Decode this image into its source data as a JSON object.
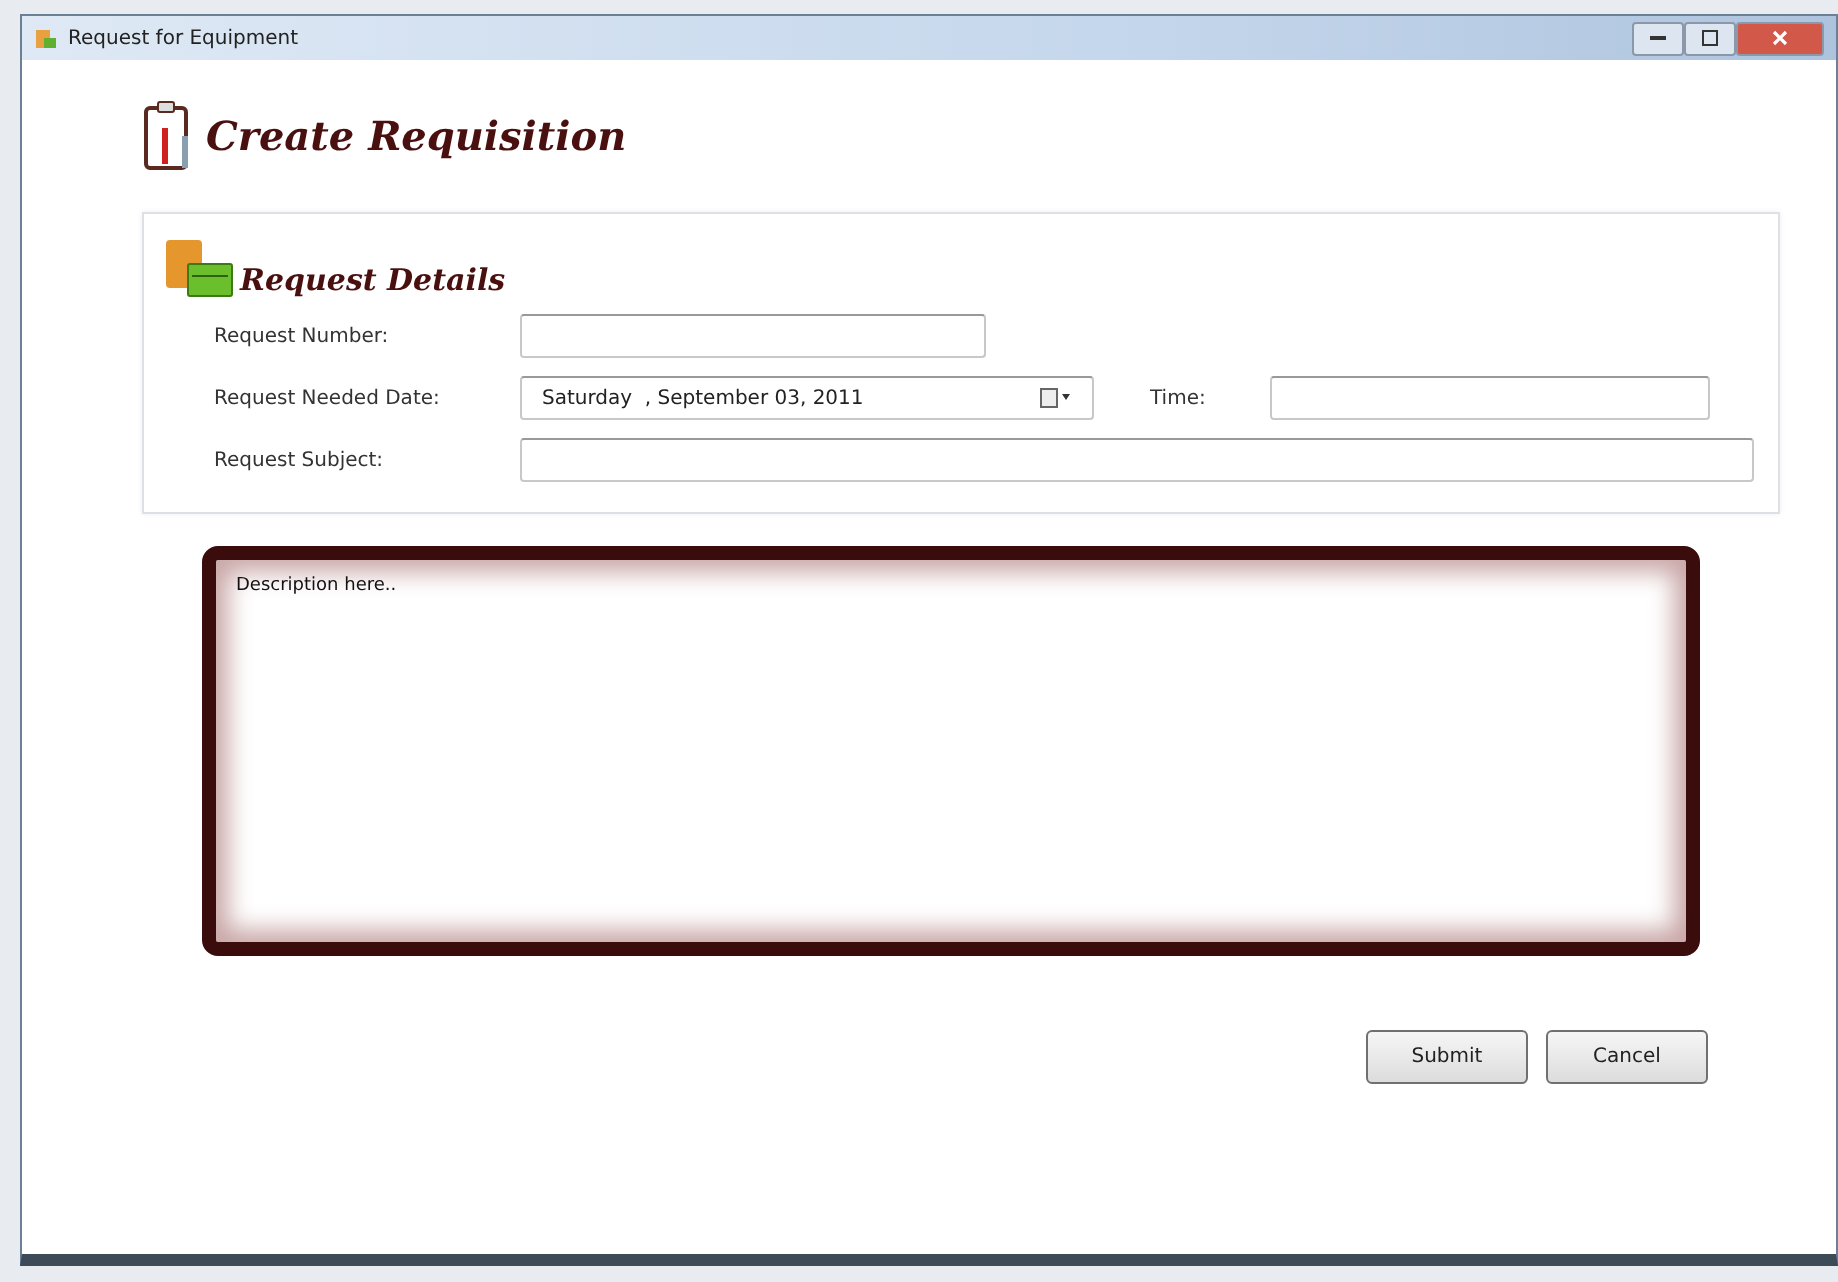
{
  "window": {
    "title": "Request for Equipment"
  },
  "header": {
    "title": "Create Requisition"
  },
  "details": {
    "title": "Request Details",
    "fields": [
      {
        "kind": "text",
        "label": "Request Number:"
      },
      {
        "kind": "date",
        "label": "Request Needed Date:",
        "value": "Saturday  , September 03, 2011",
        "extra_label": "Time:"
      },
      {
        "kind": "text",
        "label": "Request Subject:"
      }
    ]
  },
  "description": {
    "value": "Description here.."
  },
  "buttons": [
    "Submit",
    "Cancel"
  ]
}
